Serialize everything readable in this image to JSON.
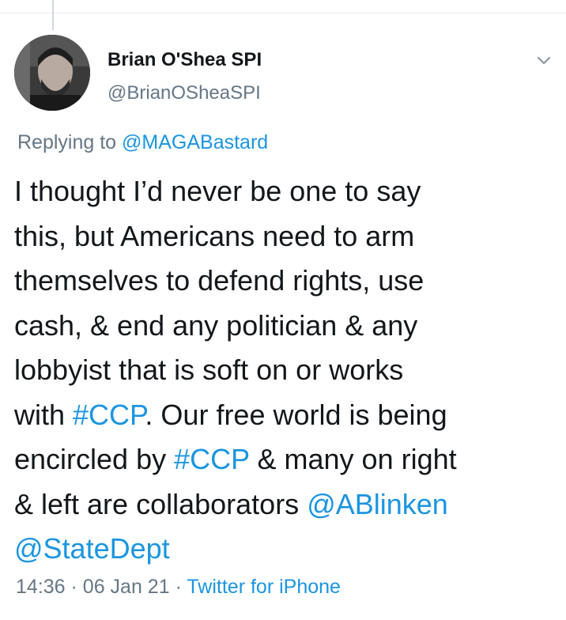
{
  "tweet": {
    "author": {
      "name": "Brian O'Shea SPI",
      "handle": "@BrianOSheaSPI",
      "avatar_icon": "person-portrait-icon"
    },
    "menu_icon": "chevron-down-icon",
    "replying": {
      "prefix": "Replying to",
      "mention": "@MAGABastard"
    },
    "text_lines": [
      [
        "I thought I’d never be one to say"
      ],
      [
        "this, but Americans need to arm"
      ],
      [
        "themselves to defend rights, use"
      ],
      [
        "cash, & end any politician & any"
      ],
      [
        "lobbyist that is soft on or works"
      ],
      [
        "with ",
        "#CCP",
        ". Our free world is being"
      ],
      [
        "encircled by ",
        "#CCP",
        " & many on right"
      ],
      [
        "& left are collaborators ",
        "@ABlinken"
      ],
      [
        "@StateDept"
      ]
    ],
    "meta": {
      "time": "14:36",
      "date": "06 Jan 21",
      "separator": "·",
      "source": "Twitter for iPhone"
    }
  },
  "colors": {
    "text": "#14171a",
    "secondary": "#657786",
    "link": "#1b95e0",
    "divider": "#e6ecf0"
  }
}
